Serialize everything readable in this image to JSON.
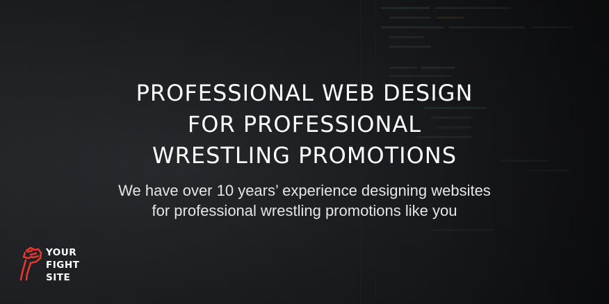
{
  "banner": {
    "headline_lines": [
      "PROFESSIONAL WEB DESIGN",
      "FOR PROFESSIONAL",
      "WRESTLING PROMOTIONS"
    ],
    "subline_lines": [
      "We have over 10 years’ experience designing websites",
      "for professional wrestling promotions like you"
    ]
  },
  "logo": {
    "lines": [
      "YOUR",
      "FIGHT",
      "SITE"
    ],
    "icon": "raised-fist-icon",
    "icon_color": "#e23a2e"
  },
  "colors": {
    "background": "#1f2124",
    "text": "#ffffff",
    "accent": "#e23a2e"
  }
}
